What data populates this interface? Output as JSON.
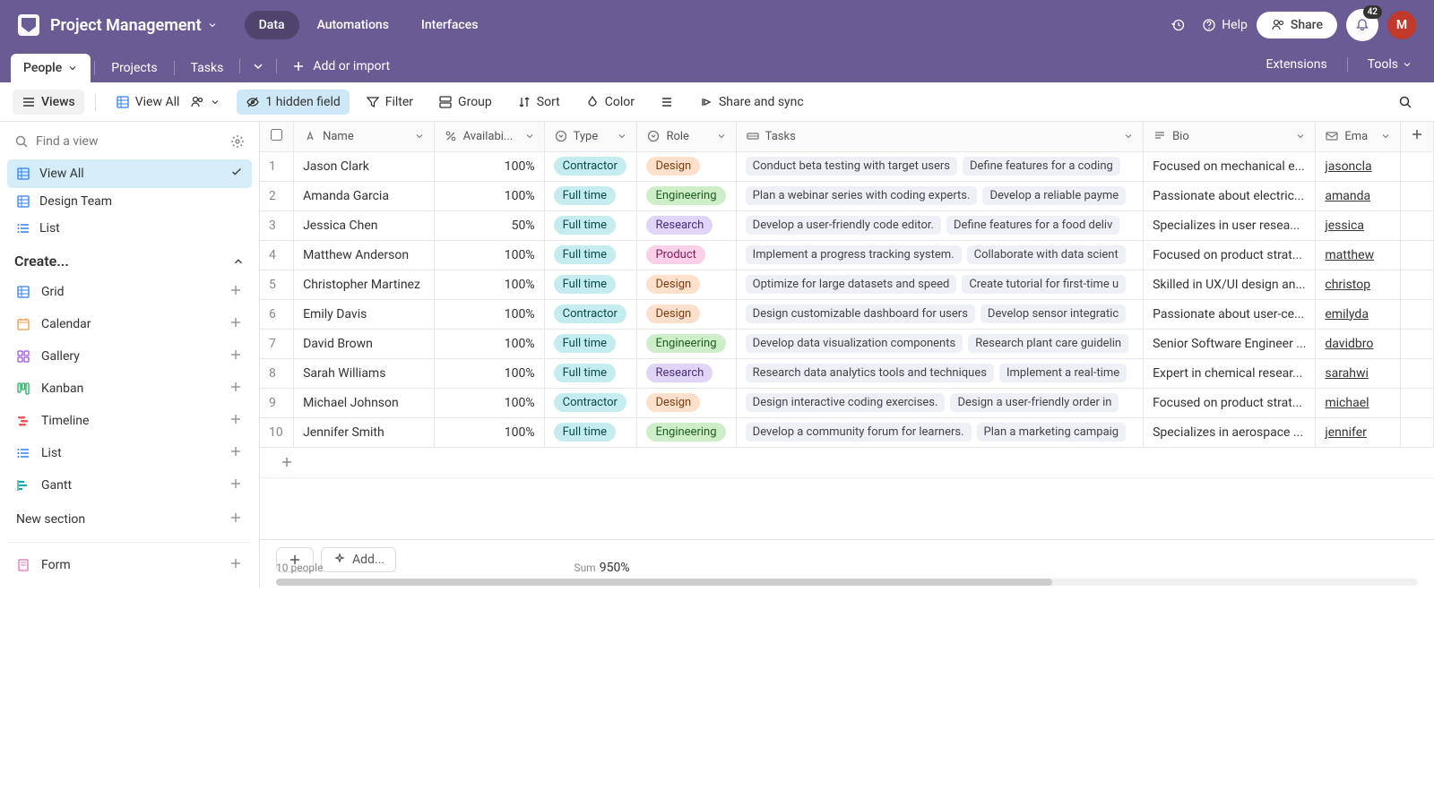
{
  "header": {
    "title": "Project Management",
    "nav": [
      "Data",
      "Automations",
      "Interfaces"
    ],
    "active_nav": 0,
    "help_label": "Help",
    "share_label": "Share",
    "badge_count": "42",
    "avatar_letter": "M"
  },
  "tabs": {
    "items": [
      "People",
      "Projects",
      "Tasks"
    ],
    "active": 0,
    "add_label": "Add or import",
    "extensions_label": "Extensions",
    "tools_label": "Tools"
  },
  "toolbar": {
    "views_label": "Views",
    "view_all_label": "View All",
    "hidden_field_label": "1 hidden field",
    "filter_label": "Filter",
    "group_label": "Group",
    "sort_label": "Sort",
    "color_label": "Color",
    "share_sync_label": "Share and sync"
  },
  "sidebar": {
    "search_placeholder": "Find a view",
    "views": [
      {
        "label": "View All",
        "icon": "grid",
        "active": true
      },
      {
        "label": "Design Team",
        "icon": "grid"
      },
      {
        "label": "List",
        "icon": "list"
      }
    ],
    "create_label": "Create...",
    "create_items": [
      {
        "label": "Grid",
        "icon": "grid",
        "color": "ic-blue"
      },
      {
        "label": "Calendar",
        "icon": "calendar",
        "color": "ic-orange"
      },
      {
        "label": "Gallery",
        "icon": "gallery",
        "color": "ic-purple"
      },
      {
        "label": "Kanban",
        "icon": "kanban",
        "color": "ic-green"
      },
      {
        "label": "Timeline",
        "icon": "timeline",
        "color": "ic-red"
      },
      {
        "label": "List",
        "icon": "list",
        "color": "ic-blue"
      },
      {
        "label": "Gantt",
        "icon": "gantt",
        "color": "ic-teal"
      }
    ],
    "new_section_label": "New section",
    "form_label": "Form"
  },
  "columns": [
    {
      "key": "num",
      "label": "",
      "width": "col-num"
    },
    {
      "key": "name",
      "label": "Name",
      "icon": "text",
      "width": "col-name"
    },
    {
      "key": "avail",
      "label": "Availabi...",
      "icon": "percent",
      "width": "col-avail"
    },
    {
      "key": "type",
      "label": "Type",
      "icon": "select",
      "width": "col-type"
    },
    {
      "key": "role",
      "label": "Role",
      "icon": "select",
      "width": "col-role"
    },
    {
      "key": "tasks",
      "label": "Tasks",
      "icon": "link",
      "width": "col-tasks"
    },
    {
      "key": "bio",
      "label": "Bio",
      "icon": "longtext",
      "width": "col-bio"
    },
    {
      "key": "email",
      "label": "Ema",
      "icon": "email",
      "width": "col-email"
    }
  ],
  "rows": [
    {
      "n": 1,
      "name": "Jason Clark",
      "avail": "100%",
      "type": "Contractor",
      "role": "Design",
      "tasks": [
        "Conduct beta testing with target users",
        "Define features for a coding"
      ],
      "bio": "Focused on mechanical e...",
      "email": "jasoncla"
    },
    {
      "n": 2,
      "name": "Amanda Garcia",
      "avail": "100%",
      "type": "Full time",
      "role": "Engineering",
      "tasks": [
        "Plan a webinar series with coding experts.",
        "Develop a reliable payme"
      ],
      "bio": "Passionate about electric...",
      "email": "amanda"
    },
    {
      "n": 3,
      "name": "Jessica Chen",
      "avail": "50%",
      "type": "Full time",
      "role": "Research",
      "tasks": [
        "Develop a user-friendly code editor.",
        "Define features for a food deliv"
      ],
      "bio": "Specializes in user resea...",
      "email": "jessica"
    },
    {
      "n": 4,
      "name": "Matthew Anderson",
      "avail": "100%",
      "type": "Full time",
      "role": "Product",
      "tasks": [
        "Implement a progress tracking system.",
        "Collaborate with data scient"
      ],
      "bio": "Focused on product strat...",
      "email": "matthew"
    },
    {
      "n": 5,
      "name": "Christopher Martinez",
      "avail": "100%",
      "type": "Full time",
      "role": "Design",
      "tasks": [
        "Optimize for large datasets and speed",
        "Create tutorial for first-time u"
      ],
      "bio": "Skilled in UX/UI design an...",
      "email": "christop"
    },
    {
      "n": 6,
      "name": "Emily Davis",
      "avail": "100%",
      "type": "Contractor",
      "role": "Design",
      "tasks": [
        "Design customizable dashboard for users",
        "Develop sensor integratic"
      ],
      "bio": "Passionate about user-ce...",
      "email": "emilyda"
    },
    {
      "n": 7,
      "name": "David Brown",
      "avail": "100%",
      "type": "Full time",
      "role": "Engineering",
      "tasks": [
        "Develop data visualization components",
        "Research plant care guidelin"
      ],
      "bio": "Senior Software Engineer ...",
      "email": "davidbro"
    },
    {
      "n": 8,
      "name": "Sarah Williams",
      "avail": "100%",
      "type": "Full time",
      "role": "Research",
      "tasks": [
        "Research data analytics tools and techniques",
        "Implement a real-time"
      ],
      "bio": "Expert in chemical resear...",
      "email": "sarahwi"
    },
    {
      "n": 9,
      "name": "Michael Johnson",
      "avail": "100%",
      "type": "Contractor",
      "role": "Design",
      "tasks": [
        "Design interactive coding exercises.",
        "Design a user-friendly order in"
      ],
      "bio": "Focused on product strat...",
      "email": "michael"
    },
    {
      "n": 10,
      "name": "Jennifer Smith",
      "avail": "100%",
      "type": "Full time",
      "role": "Engineering",
      "tasks": [
        "Develop a community forum for learners.",
        "Plan a marketing campaig"
      ],
      "bio": "Specializes in aerospace ...",
      "email": "jennifer"
    }
  ],
  "footer": {
    "add_label": "Add...",
    "count_label": "10 people",
    "sum_label": "Sum",
    "sum_value": "950%"
  },
  "type_colors": {
    "Contractor": "contractor",
    "Full time": "fulltime"
  },
  "role_colors": {
    "Design": "design",
    "Engineering": "engineering",
    "Research": "research",
    "Product": "product"
  }
}
